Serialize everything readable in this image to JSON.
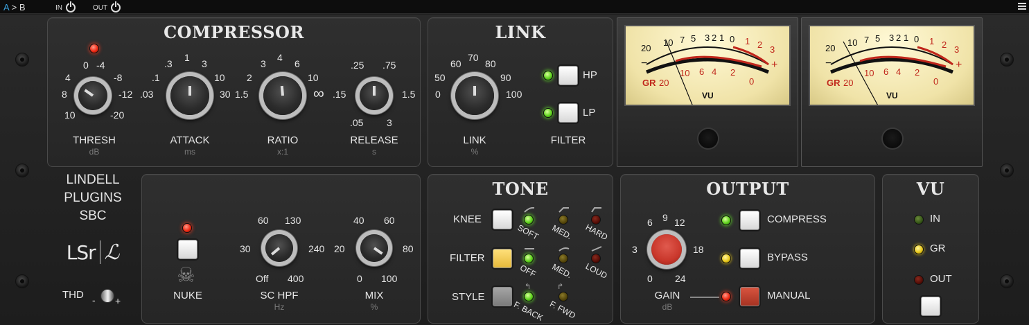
{
  "topbar": {
    "ab_a": "A",
    "ab_arrow": ">",
    "ab_b": "B",
    "in_label": "IN",
    "out_label": "OUT",
    "menu_icon": "hamburger-icon"
  },
  "compressor": {
    "title": "COMPRESSOR",
    "thresh": {
      "label": "THRESH",
      "unit": "dB",
      "scale": [
        "0",
        "-4",
        "4",
        "-8",
        "8",
        "-12",
        "10",
        "-20"
      ]
    },
    "attack": {
      "label": "ATTACK",
      "unit": "ms",
      "scale": [
        ".3",
        "1",
        "3",
        ".1",
        "10",
        ".03",
        "30"
      ]
    },
    "ratio": {
      "label": "RATIO",
      "unit": "x:1",
      "scale": [
        "3",
        "4",
        "6",
        "2",
        "10",
        "1.5",
        "∞"
      ]
    },
    "release": {
      "label": "RELEASE",
      "unit": "s",
      "scale": [
        ".25",
        ".75",
        ".15",
        "1.5",
        ".05",
        "3"
      ]
    }
  },
  "link": {
    "title": "LINK",
    "knob": {
      "label": "LINK",
      "unit": "%",
      "scale": [
        "60",
        "70",
        "80",
        "50",
        "90",
        "0",
        "100"
      ]
    },
    "filter": {
      "label": "FILTER",
      "hp": "HP",
      "lp": "LP"
    }
  },
  "brand": {
    "line1": "LINDELL",
    "line2": "PLUGINS",
    "line3": "SBC",
    "logo_a": "LSr",
    "logo_b": "ℒ",
    "thd": "THD",
    "minus": "-",
    "plus": "+"
  },
  "mid": {
    "nuke": {
      "label": "NUKE",
      "icon": "skull-crossbones-icon"
    },
    "schpf": {
      "label": "SC HPF",
      "unit": "Hz",
      "scale": [
        "60",
        "130",
        "30",
        "240",
        "Off",
        "400"
      ]
    },
    "mix": {
      "label": "MIX",
      "unit": "%",
      "scale": [
        "40",
        "60",
        "20",
        "80",
        "0",
        "100"
      ]
    }
  },
  "tone": {
    "title": "TONE",
    "rows": [
      {
        "label": "KNEE",
        "options": [
          "SOFT",
          "MED.",
          "HARD"
        ]
      },
      {
        "label": "FILTER",
        "options": [
          "OFF",
          "MED.",
          "LOUD"
        ]
      },
      {
        "label": "STYLE",
        "options": [
          "F. BACK",
          "F. FWD"
        ]
      }
    ]
  },
  "output": {
    "title": "OUTPUT",
    "gain": {
      "label": "GAIN",
      "unit": "dB",
      "scale": [
        "9",
        "6",
        "12",
        "3",
        "18",
        "0",
        "24"
      ]
    },
    "modes": [
      "COMPRESS",
      "BYPASS",
      "MANUAL"
    ]
  },
  "vu_panel": {
    "title": "VU",
    "items": [
      "IN",
      "GR",
      "OUT"
    ]
  },
  "meter": {
    "top_scale": [
      "20",
      "10",
      "7",
      "5",
      "3",
      "2",
      "1",
      "0",
      "1",
      "2",
      "3"
    ],
    "gr_scale": [
      "GR",
      "20",
      "10",
      "6",
      "4",
      "2",
      "0"
    ],
    "vu_label": "VU",
    "minus": "−",
    "plus": "+"
  },
  "colors": {
    "accent": "#3aa3e0",
    "led_green": "#5fd21e",
    "led_yellow": "#e8c81c",
    "led_red": "#ef2a14",
    "meter_red": "#c0261b"
  }
}
